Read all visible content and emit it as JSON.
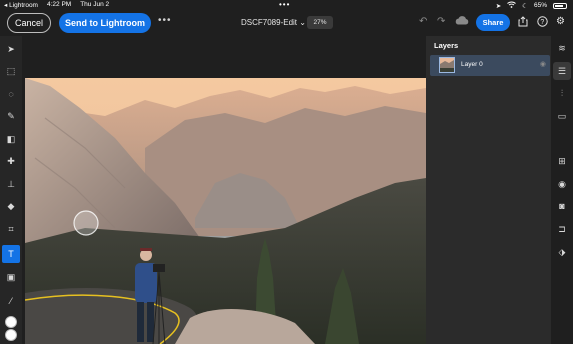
{
  "status": {
    "back_app": "◂ Lightroom",
    "time": "4:22 PM",
    "date": "Thu Jun 2",
    "battery": "65%"
  },
  "toolbar": {
    "cancel_label": "Cancel",
    "send_label": "Send to Lightroom",
    "doc_title": "DSCF7089-Edit ⌄",
    "zoom": "27%",
    "share_label": "Share"
  },
  "layers": {
    "title": "Layers",
    "items": [
      {
        "label": "Layer 0"
      }
    ]
  }
}
